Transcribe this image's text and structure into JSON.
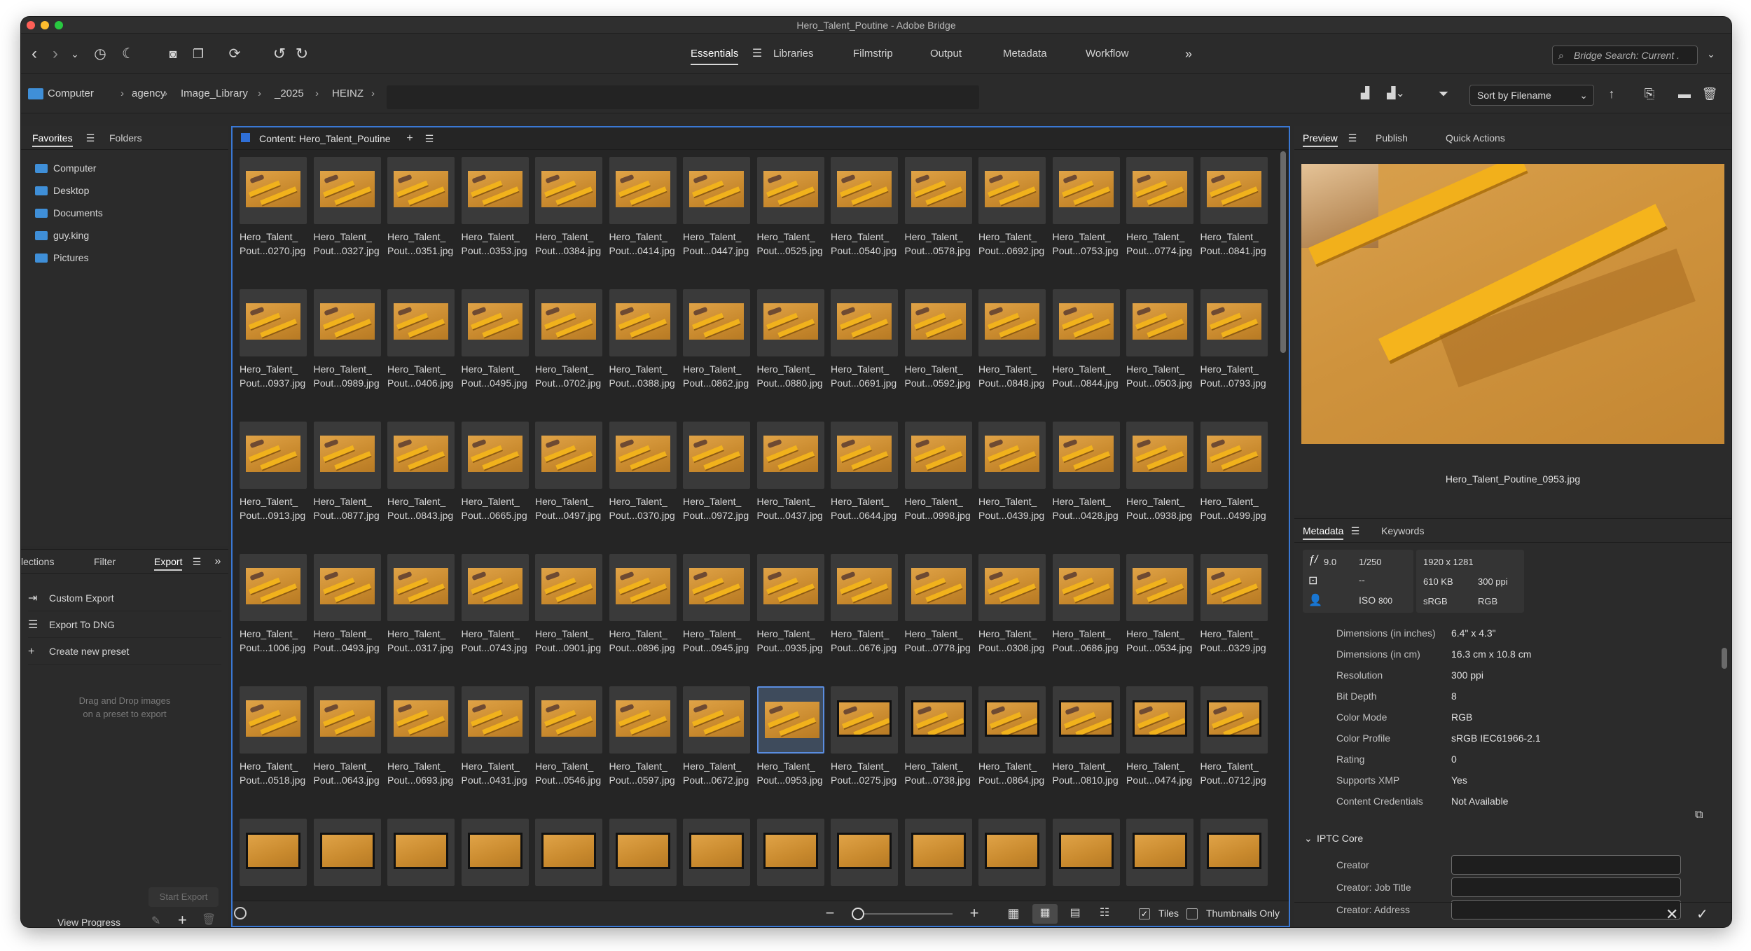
{
  "window": {
    "title": "Hero_Talent_Poutine - Adobe Bridge"
  },
  "toolbar": {
    "workspaces": [
      "Essentials",
      "Libraries",
      "Filmstrip",
      "Output",
      "Metadata",
      "Workflow"
    ],
    "active_workspace": "Essentials",
    "search_placeholder": "Bridge Search: Current ."
  },
  "path_bar": {
    "crumbs": [
      "Computer",
      "agency",
      "Image_Library",
      "_2025",
      "HEINZ"
    ],
    "sort_label": "Sort by Filename"
  },
  "left_top": {
    "tabs": [
      "Favorites",
      "Folders"
    ],
    "favorites": [
      "Computer",
      "Desktop",
      "Documents",
      "guy.king",
      "Pictures"
    ]
  },
  "left_bottom": {
    "tabs": [
      "lections",
      "Filter",
      "Export"
    ],
    "items": [
      "Custom Export",
      "Export To DNG",
      "Create new preset"
    ],
    "drop_hint_line1": "Drag and Drop images",
    "drop_hint_line2": "on a preset to export",
    "start_export": "Start Export",
    "view_progress": "View Progress"
  },
  "content": {
    "title": "Content: Hero_Talent_Poutine",
    "name_prefix": "Hero_Talent_",
    "rows": [
      [
        "Pout...0270.jpg",
        "Pout...0327.jpg",
        "Pout...0351.jpg",
        "Pout...0353.jpg",
        "Pout...0384.jpg",
        "Pout...0414.jpg",
        "Pout...0447.jpg",
        "Pout...0525.jpg",
        "Pout...0540.jpg",
        "Pout...0578.jpg",
        "Pout...0692.jpg",
        "Pout...0753.jpg",
        "Pout...0774.jpg",
        "Pout...0841.jpg"
      ],
      [
        "Pout...0937.jpg",
        "Pout...0989.jpg",
        "Pout...0406.jpg",
        "Pout...0495.jpg",
        "Pout...0702.jpg",
        "Pout...0388.jpg",
        "Pout...0862.jpg",
        "Pout...0880.jpg",
        "Pout...0691.jpg",
        "Pout...0592.jpg",
        "Pout...0848.jpg",
        "Pout...0844.jpg",
        "Pout...0503.jpg",
        "Pout...0793.jpg"
      ],
      [
        "Pout...0913.jpg",
        "Pout...0877.jpg",
        "Pout...0843.jpg",
        "Pout...0665.jpg",
        "Pout...0497.jpg",
        "Pout...0370.jpg",
        "Pout...0972.jpg",
        "Pout...0437.jpg",
        "Pout...0644.jpg",
        "Pout...0998.jpg",
        "Pout...0439.jpg",
        "Pout...0428.jpg",
        "Pout...0938.jpg",
        "Pout...0499.jpg"
      ],
      [
        "Pout...1006.jpg",
        "Pout...0493.jpg",
        "Pout...0317.jpg",
        "Pout...0743.jpg",
        "Pout...0901.jpg",
        "Pout...0896.jpg",
        "Pout...0945.jpg",
        "Pout...0935.jpg",
        "Pout...0676.jpg",
        "Pout...0778.jpg",
        "Pout...0308.jpg",
        "Pout...0686.jpg",
        "Pout...0534.jpg",
        "Pout...0329.jpg"
      ],
      [
        "Pout...0518.jpg",
        "Pout...0643.jpg",
        "Pout...0693.jpg",
        "Pout...0431.jpg",
        "Pout...0546.jpg",
        "Pout...0597.jpg",
        "Pout...0672.jpg",
        "Pout...0953.jpg",
        "Pout...0275.jpg",
        "Pout...0738.jpg",
        "Pout...0864.jpg",
        "Pout...0810.jpg",
        "Pout...0474.jpg",
        "Pout...0712.jpg"
      ]
    ],
    "selected_row": 4,
    "selected_col": 7,
    "tiles_label": "Tiles",
    "thumbs_only_label": "Thumbnails Only"
  },
  "preview": {
    "tabs": [
      "Preview",
      "Publish",
      "Quick Actions"
    ],
    "filename": "Hero_Talent_Poutine_0953.jpg"
  },
  "metadata": {
    "tabs": [
      "Metadata",
      "Keywords"
    ],
    "placard": {
      "aperture": "9.0",
      "shutter": "1/250",
      "exposure_comp": "--",
      "iso": "800",
      "dimensions": "1920 x 1281",
      "size": "610 KB",
      "ppi": "300 ppi",
      "colorspace": "sRGB",
      "mode": "RGB"
    },
    "rows": [
      {
        "k": "Dimensions (in inches)",
        "v": "6.4\" x 4.3\""
      },
      {
        "k": "Dimensions (in cm)",
        "v": "16.3 cm x 10.8 cm"
      },
      {
        "k": "Resolution",
        "v": "300 ppi"
      },
      {
        "k": "Bit Depth",
        "v": "8"
      },
      {
        "k": "Color Mode",
        "v": "RGB"
      },
      {
        "k": "Color Profile",
        "v": "sRGB IEC61966-2.1"
      },
      {
        "k": "Rating",
        "v": "0"
      },
      {
        "k": "Supports XMP",
        "v": "Yes"
      },
      {
        "k": "Content Credentials",
        "v": "Not Available"
      }
    ],
    "iptc_header": "IPTC Core",
    "iptc_fields": [
      "Creator",
      "Creator: Job Title",
      "Creator: Address"
    ]
  }
}
